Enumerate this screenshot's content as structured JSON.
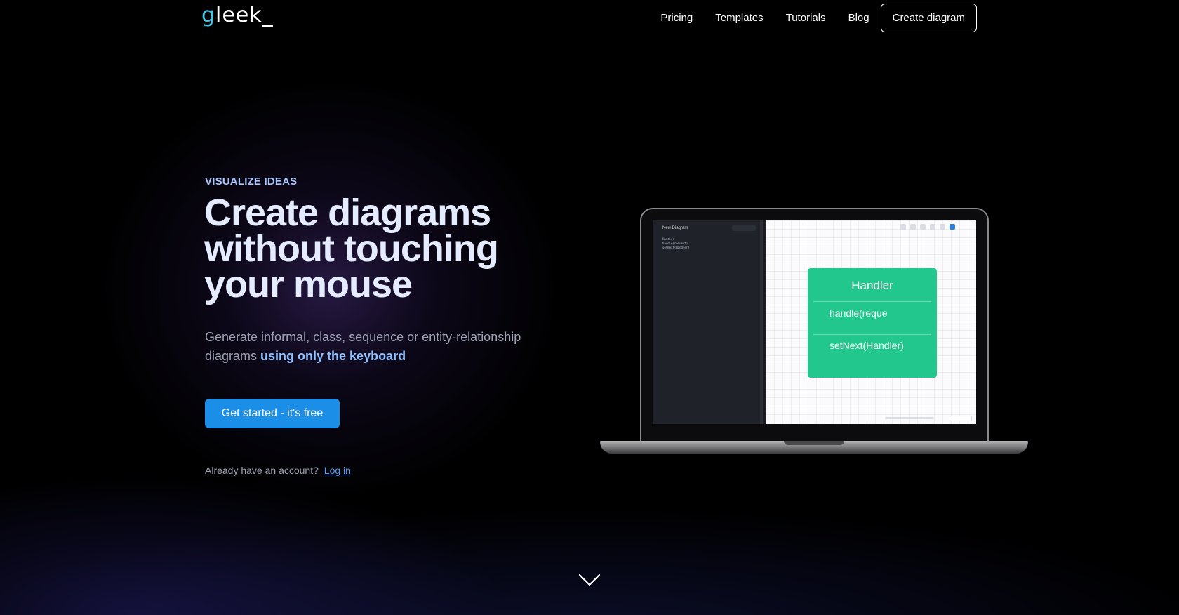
{
  "header": {
    "logo_first": "g",
    "logo_rest": "leek_",
    "nav": [
      "Pricing",
      "Templates",
      "Tutorials",
      "Blog"
    ],
    "cta": "Create diagram"
  },
  "hero": {
    "eyebrow": "VISUALIZE IDEAS",
    "headline": "Create diagrams without touching your mouse",
    "subtext_plain": "Generate informal, class, sequence or entity-relationship diagrams",
    "subtext_highlight": "using only the keyboard",
    "primary_button": "Get started - it's free",
    "login_prompt": "Already have an account?",
    "login_link": "Log in"
  },
  "laptop": {
    "editor_title": "New Diagram",
    "editor_code": [
      "Handler",
      "  handle(request)",
      "  setNext(Handler)"
    ],
    "class_name": "Handler",
    "methods": [
      "handle(reque",
      "setNext(Handler)"
    ]
  },
  "icons": {
    "scroll_down": "chevron-down-icon"
  },
  "colors": {
    "accent_blue": "#1b8fe8",
    "class_box_green": "#22c78e",
    "eyebrow": "#a8c8ff",
    "logo_g": "#3ec7e8"
  }
}
